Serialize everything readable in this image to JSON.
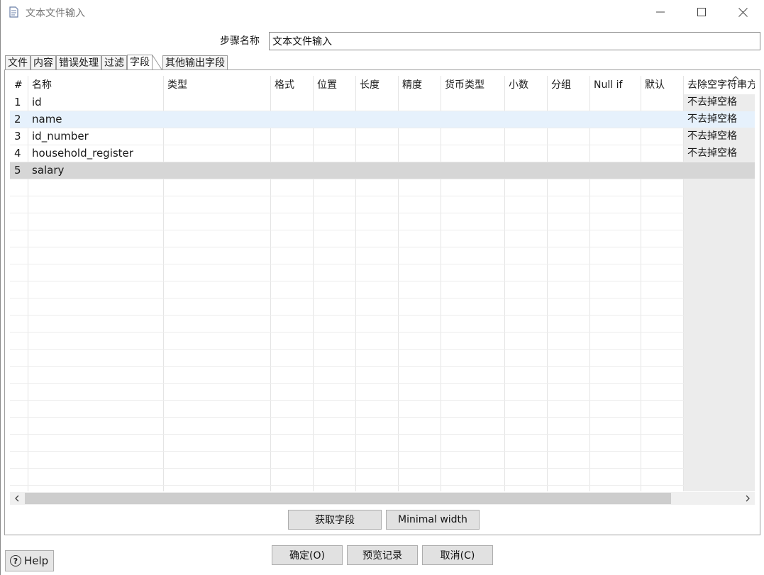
{
  "window": {
    "title": "文本文件输入",
    "min_glyph": "—",
    "max_glyph": "☐",
    "close_glyph": "✕"
  },
  "step": {
    "label": "步骤名称",
    "value": "文本文件输入"
  },
  "tabs": [
    {
      "label": "文件",
      "active": false
    },
    {
      "label": "内容",
      "active": false
    },
    {
      "label": "错误处理",
      "active": false
    },
    {
      "label": "过滤",
      "active": false
    },
    {
      "label": "字段",
      "active": true
    },
    {
      "label": "其他输出字段",
      "active": false
    }
  ],
  "table": {
    "columns": [
      "#",
      "名称",
      "类型",
      "格式",
      "位置",
      "长度",
      "精度",
      "货币类型",
      "小数",
      "分组",
      "Null if",
      "默认",
      "去除空字符串方"
    ],
    "rows": [
      {
        "num": "1",
        "name": "id",
        "trim": "不去掉空格"
      },
      {
        "num": "2",
        "name": "name",
        "trim": "不去掉空格"
      },
      {
        "num": "3",
        "name": "id_number",
        "trim": "不去掉空格"
      },
      {
        "num": "4",
        "name": "household_register",
        "trim": "不去掉空格"
      },
      {
        "num": "5",
        "name": "salary",
        "trim": ""
      }
    ],
    "selected_row": 2
  },
  "field_buttons": {
    "get_fields": "获取字段",
    "minimal_width": "Minimal width"
  },
  "footer": {
    "help": "Help",
    "ok": "确定(O)",
    "preview": "预览记录",
    "cancel": "取消(C)"
  },
  "scroll": {
    "left_glyph": "‹",
    "right_glyph": "›",
    "up_glyph": "^"
  }
}
